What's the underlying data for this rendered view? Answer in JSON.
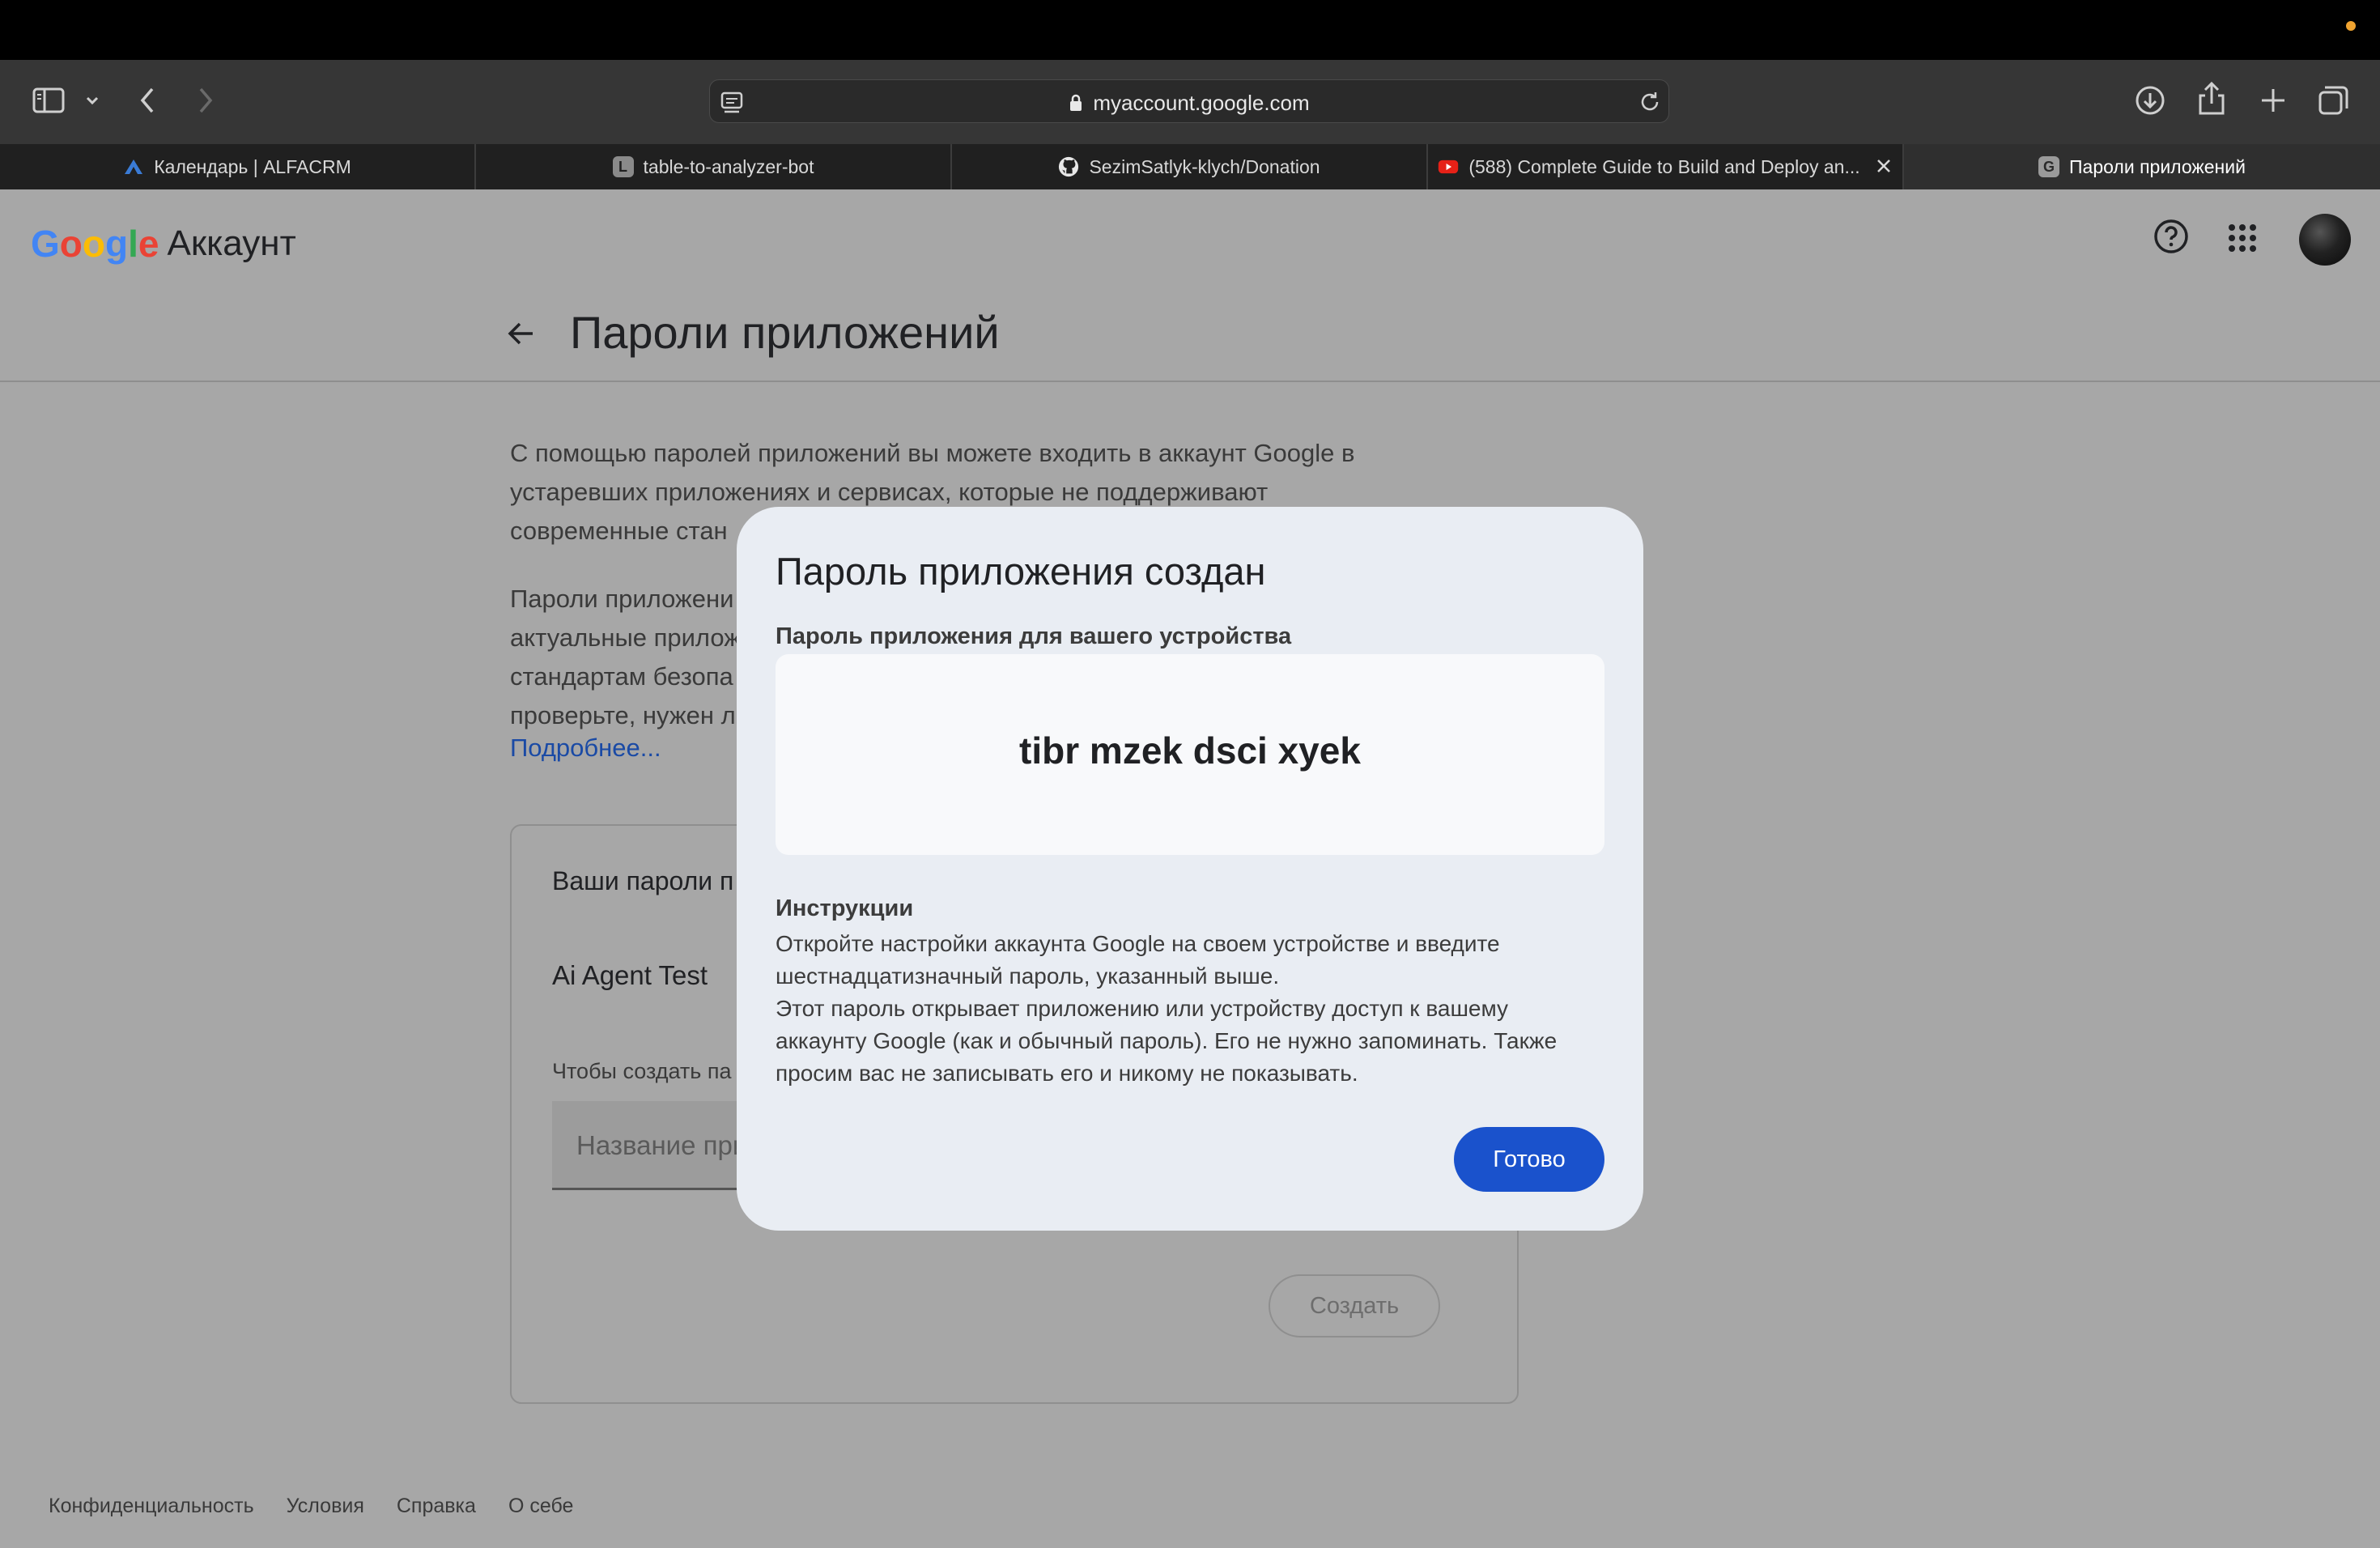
{
  "browser": {
    "url": "myaccount.google.com",
    "tabs": [
      {
        "label": "Календарь | ALFACRM",
        "icon": "alfacrm-icon"
      },
      {
        "label": "table-to-analyzer-bot",
        "icon": "l-letter-icon",
        "favicon_letter": "L"
      },
      {
        "label": "SezimSatlyk-klych/Donation",
        "icon": "github-icon"
      },
      {
        "label": "(588) Complete Guide to Build and Deploy an...",
        "icon": "youtube-icon"
      },
      {
        "label": "Пароли приложений",
        "icon": "g-letter-icon",
        "favicon_letter": "G",
        "active": true
      }
    ],
    "accent_color": "#f0a330"
  },
  "header": {
    "logo_google": "Google",
    "logo_account": "Аккаунт"
  },
  "main": {
    "title": "Пароли приложений",
    "intro_lines": [
      "С помощью паролей приложений вы можете входить в аккаунт Google в",
      "устаревших приложениях и сервисах, которые не поддерживают",
      "современные стан"
    ],
    "second_lines": [
      "Пароли приложени",
      "актуальные прилож",
      "стандартам безопа",
      "проверьте, нужен л"
    ],
    "learn_more": "Подробнее...",
    "card": {
      "title": "Ваши пароли п",
      "items": [
        "Ai Agent Test"
      ],
      "create_hint": "Чтобы создать па",
      "name_placeholder": "Название при",
      "create_button": "Создать"
    }
  },
  "footer": {
    "links": [
      "Конфиденциальность",
      "Условия",
      "Справка",
      "О себе"
    ]
  },
  "modal": {
    "title": "Пароль приложения создан",
    "password_label": "Пароль приложения для вашего устройства",
    "password_value": "tibr mzek dsci xyek",
    "instructions_title": "Инструкции",
    "instruction_lines": [
      "Откройте настройки аккаунта Google на своем устройстве и введите",
      "шестнадцатизначный пароль, указанный выше.",
      "Этот пароль открывает приложению или устройству доступ к вашему",
      "аккаунту Google (как и обычный пароль). Его не нужно запоминать. Также",
      "просим вас не записывать его и никому не показывать."
    ],
    "done_button": "Готово",
    "button_color": "#1a52cc"
  }
}
